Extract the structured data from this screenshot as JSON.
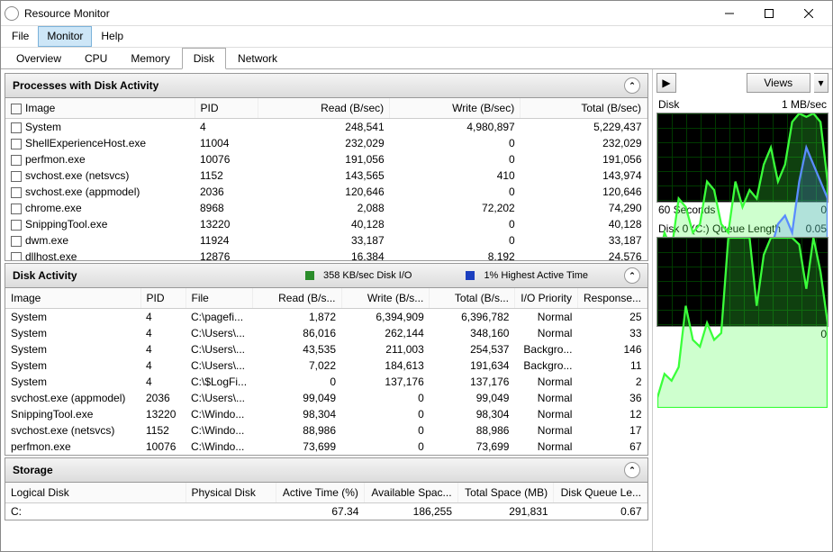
{
  "window": {
    "title": "Resource Monitor"
  },
  "menu": {
    "file": "File",
    "monitor": "Monitor",
    "help": "Help"
  },
  "tabs": {
    "overview": "Overview",
    "cpu": "CPU",
    "memory": "Memory",
    "disk": "Disk",
    "network": "Network"
  },
  "side": {
    "views": "Views",
    "graph1": {
      "title": "Disk",
      "scale": "1 MB/sec",
      "xlabel": "60 Seconds",
      "xmax": "0"
    },
    "graph2": {
      "title": "Disk 0 (C:) Queue Length",
      "scale": "0.05",
      "xmax": "0"
    }
  },
  "p1": {
    "title": "Processes with Disk Activity",
    "cols": {
      "image": "Image",
      "pid": "PID",
      "read": "Read (B/sec)",
      "write": "Write (B/sec)",
      "total": "Total (B/sec)"
    },
    "rows": [
      {
        "image": "System",
        "pid": "4",
        "read": "248,541",
        "write": "4,980,897",
        "total": "5,229,437"
      },
      {
        "image": "ShellExperienceHost.exe",
        "pid": "11004",
        "read": "232,029",
        "write": "0",
        "total": "232,029"
      },
      {
        "image": "perfmon.exe",
        "pid": "10076",
        "read": "191,056",
        "write": "0",
        "total": "191,056"
      },
      {
        "image": "svchost.exe (netsvcs)",
        "pid": "1152",
        "read": "143,565",
        "write": "410",
        "total": "143,974"
      },
      {
        "image": "svchost.exe (appmodel)",
        "pid": "2036",
        "read": "120,646",
        "write": "0",
        "total": "120,646"
      },
      {
        "image": "chrome.exe",
        "pid": "8968",
        "read": "2,088",
        "write": "72,202",
        "total": "74,290"
      },
      {
        "image": "SnippingTool.exe",
        "pid": "13220",
        "read": "40,128",
        "write": "0",
        "total": "40,128"
      },
      {
        "image": "dwm.exe",
        "pid": "11924",
        "read": "33,187",
        "write": "0",
        "total": "33,187"
      },
      {
        "image": "dllhost.exe",
        "pid": "12876",
        "read": "16,384",
        "write": "8,192",
        "total": "24,576"
      }
    ]
  },
  "p2": {
    "title": "Disk Activity",
    "stat1": "358 KB/sec Disk I/O",
    "stat2": "1% Highest Active Time",
    "cols": {
      "image": "Image",
      "pid": "PID",
      "file": "File",
      "read": "Read (B/s...",
      "write": "Write (B/s...",
      "total": "Total (B/s...",
      "io": "I/O Priority",
      "resp": "Response..."
    },
    "rows": [
      {
        "image": "System",
        "pid": "4",
        "file": "C:\\pagefi...",
        "read": "1,872",
        "write": "6,394,909",
        "total": "6,396,782",
        "io": "Normal",
        "resp": "25"
      },
      {
        "image": "System",
        "pid": "4",
        "file": "C:\\Users\\...",
        "read": "86,016",
        "write": "262,144",
        "total": "348,160",
        "io": "Normal",
        "resp": "33"
      },
      {
        "image": "System",
        "pid": "4",
        "file": "C:\\Users\\...",
        "read": "43,535",
        "write": "211,003",
        "total": "254,537",
        "io": "Backgro...",
        "resp": "146"
      },
      {
        "image": "System",
        "pid": "4",
        "file": "C:\\Users\\...",
        "read": "7,022",
        "write": "184,613",
        "total": "191,634",
        "io": "Backgro...",
        "resp": "11"
      },
      {
        "image": "System",
        "pid": "4",
        "file": "C:\\$LogFi...",
        "read": "0",
        "write": "137,176",
        "total": "137,176",
        "io": "Normal",
        "resp": "2"
      },
      {
        "image": "svchost.exe (appmodel)",
        "pid": "2036",
        "file": "C:\\Users\\...",
        "read": "99,049",
        "write": "0",
        "total": "99,049",
        "io": "Normal",
        "resp": "36"
      },
      {
        "image": "SnippingTool.exe",
        "pid": "13220",
        "file": "C:\\Windo...",
        "read": "98,304",
        "write": "0",
        "total": "98,304",
        "io": "Normal",
        "resp": "12"
      },
      {
        "image": "svchost.exe (netsvcs)",
        "pid": "1152",
        "file": "C:\\Windo...",
        "read": "88,986",
        "write": "0",
        "total": "88,986",
        "io": "Normal",
        "resp": "17"
      },
      {
        "image": "perfmon.exe",
        "pid": "10076",
        "file": "C:\\Windo...",
        "read": "73,699",
        "write": "0",
        "total": "73,699",
        "io": "Normal",
        "resp": "67"
      }
    ]
  },
  "p3": {
    "title": "Storage",
    "cols": {
      "ld": "Logical Disk",
      "pd": "Physical Disk",
      "at": "Active Time (%)",
      "avail": "Available Spac...",
      "total": "Total Space (MB)",
      "q": "Disk Queue Le..."
    },
    "rows": [
      {
        "ld": "C:",
        "pd": "",
        "at": "67.34",
        "avail": "186,255",
        "total": "291,831",
        "q": "0.67"
      }
    ]
  },
  "chart_data": [
    {
      "type": "line",
      "title": "Disk",
      "ylabel": "1 MB/sec",
      "xlabel": "60 Seconds",
      "xlim": [
        0,
        60
      ],
      "ylim": [
        0,
        1
      ],
      "series": [
        {
          "name": "total",
          "color": "#3aff3a",
          "values": [
            0.1,
            0.3,
            0.2,
            0.5,
            0.45,
            0.3,
            0.35,
            0.6,
            0.55,
            0.35,
            0.3,
            0.6,
            0.45,
            0.55,
            0.5,
            0.7,
            0.8,
            0.6,
            0.7,
            0.95,
            1.0,
            0.98,
            1.0,
            0.95,
            0.6
          ]
        },
        {
          "name": "active",
          "color": "#5a8cff",
          "values": [
            0.05,
            0.05,
            0.06,
            0.05,
            0.07,
            0.05,
            0.06,
            0.05,
            0.05,
            0.06,
            0.06,
            0.05,
            0.06,
            0.06,
            0.05,
            0.07,
            0.2,
            0.35,
            0.4,
            0.3,
            0.6,
            0.8,
            0.7,
            0.6,
            0.5
          ]
        }
      ]
    },
    {
      "type": "line",
      "title": "Disk 0 (C:) Queue Length",
      "ylabel": "0.05",
      "xlim": [
        0,
        60
      ],
      "ylim": [
        0,
        0.05
      ],
      "series": [
        {
          "name": "queue",
          "color": "#3aff3a",
          "values": [
            0.003,
            0.01,
            0.008,
            0.012,
            0.03,
            0.02,
            0.018,
            0.025,
            0.02,
            0.022,
            0.05,
            0.05,
            0.05,
            0.05,
            0.03,
            0.045,
            0.05,
            0.05,
            0.05,
            0.05,
            0.048,
            0.035,
            0.05,
            0.04,
            0.025
          ]
        }
      ]
    }
  ]
}
